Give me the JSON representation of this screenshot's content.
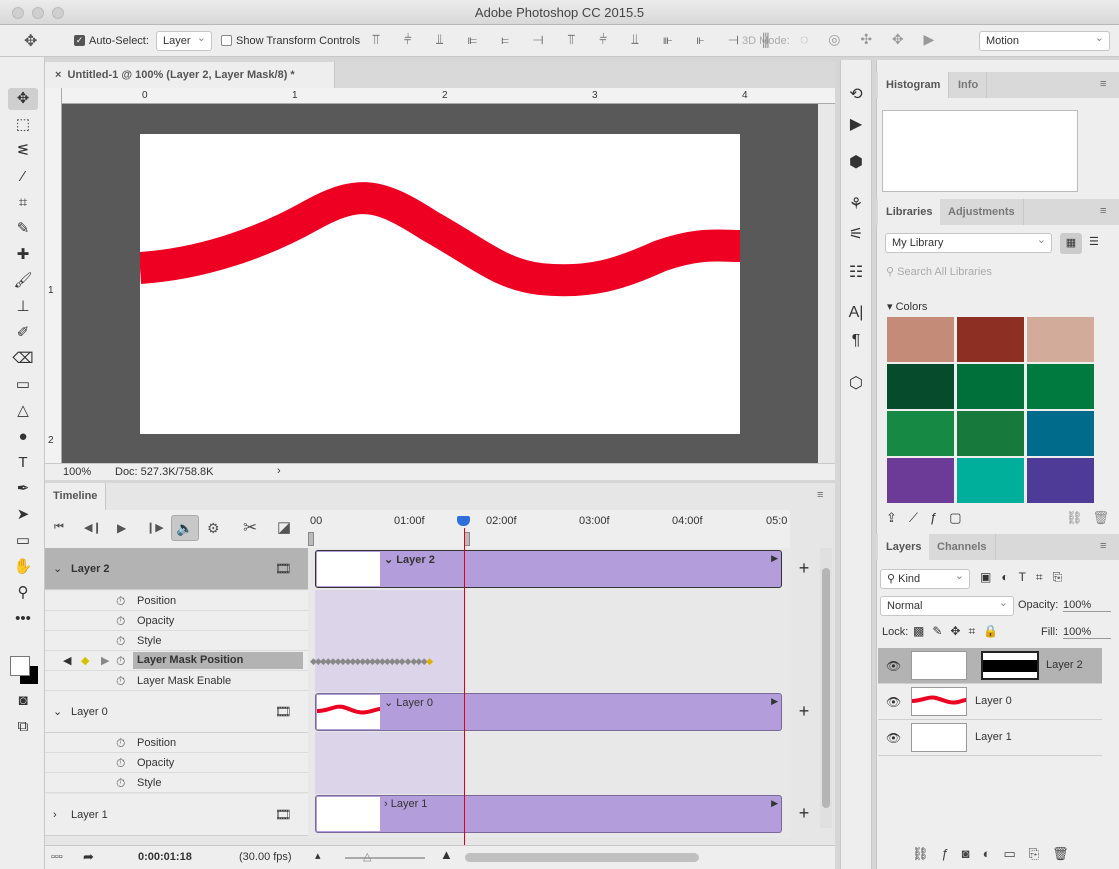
{
  "app": {
    "title": "Adobe Photoshop CC 2015.5"
  },
  "options": {
    "auto_select_label": "Auto-Select:",
    "auto_select_checked": true,
    "auto_select_value": "Layer",
    "show_transform_label": "Show Transform Controls",
    "show_transform_checked": false,
    "mode_3d_label": "3D Mode:",
    "workspace": "Motion"
  },
  "document": {
    "tab_title": "Untitled-1 @ 100% (Layer 2, Layer Mask/8) *",
    "ruler_h": [
      "0",
      "1",
      "2",
      "3",
      "4"
    ],
    "ruler_v": [
      "1",
      "2"
    ],
    "zoom": "100%",
    "doc_size": "Doc: 527.3K/758.8K",
    "stroke_color": "#ee0022"
  },
  "timeline": {
    "tab": "Timeline",
    "ruler": [
      "00",
      "01:00f",
      "02:00f",
      "03:00f",
      "04:00f",
      "05:0"
    ],
    "current_time": "0:00:01:18",
    "fps": "(30.00 fps)",
    "layers": [
      {
        "name": "Layer 2",
        "expanded": true,
        "props": [
          "Position",
          "Opacity",
          "Style",
          "Layer Mask Position",
          "Layer Mask Enable"
        ]
      },
      {
        "name": "Layer 0",
        "expanded": true,
        "props": [
          "Position",
          "Opacity",
          "Style"
        ]
      },
      {
        "name": "Layer 1",
        "expanded": false,
        "props": []
      }
    ],
    "clip_color": "#b39ddb",
    "playhead_color": "#e0001b"
  },
  "histogram": {
    "tabs": [
      "Histogram",
      "Info"
    ]
  },
  "libraries": {
    "tabs": [
      "Libraries",
      "Adjustments"
    ],
    "library": "My Library",
    "search_placeholder": "Search All Libraries",
    "colors_label": "Colors",
    "swatches": [
      "#c48b78",
      "#8d3023",
      "#d3ab9b",
      "#064b2b",
      "#00703b",
      "#007a3e",
      "#168a45",
      "#177a3c",
      "#006b8a",
      "#6b3b97",
      "#00af9b",
      "#4e3a97"
    ]
  },
  "layers_panel": {
    "tabs": [
      "Layers",
      "Channels"
    ],
    "filter": "Kind",
    "blend": "Normal",
    "opacity_label": "Opacity:",
    "opacity": "100%",
    "lock_label": "Lock:",
    "fill_label": "Fill:",
    "fill": "100%",
    "layers": [
      {
        "name": "Layer 2",
        "selected": true
      },
      {
        "name": "Layer 0",
        "selected": false
      },
      {
        "name": "Layer 1",
        "selected": false
      }
    ]
  }
}
